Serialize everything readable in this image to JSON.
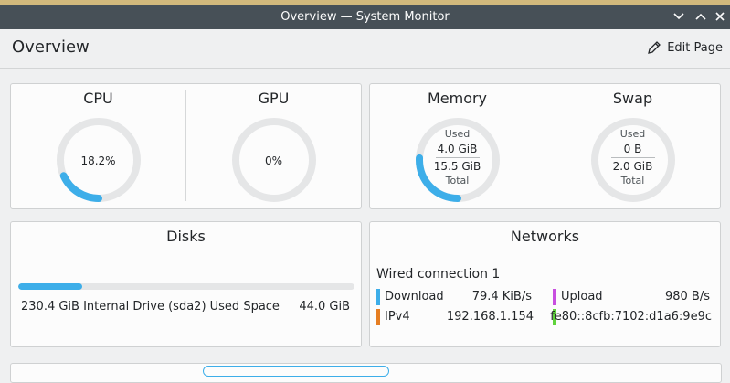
{
  "window": {
    "title": "Overview — System Monitor"
  },
  "header": {
    "title": "Overview",
    "edit_label": "Edit Page"
  },
  "colors": {
    "accent": "#3daee9",
    "ipv4": "#e67e22",
    "upload": "#c84fe0",
    "ipv6": "#5fd33b"
  },
  "cpu": {
    "title": "CPU",
    "value_text": "18.2%",
    "fraction": 0.182
  },
  "gpu": {
    "title": "GPU",
    "value_text": "0%",
    "fraction": 0.0
  },
  "memory": {
    "title": "Memory",
    "used_label": "Used",
    "used": "4.0 GiB",
    "total": "15.5 GiB",
    "total_label": "Total",
    "fraction": 0.258
  },
  "swap": {
    "title": "Swap",
    "used_label": "Used",
    "used": "0 B",
    "total": "2.0 GiB",
    "total_label": "Total",
    "fraction": 0.0
  },
  "disks": {
    "title": "Disks",
    "drive_label": "230.4 GiB Internal Drive (sda2) Used Space",
    "used": "44.0 GiB",
    "fraction": 0.19
  },
  "networks": {
    "title": "Networks",
    "connection": "Wired connection 1",
    "download_label": "Download",
    "download": "79.4 KiB/s",
    "upload_label": "Upload",
    "upload": "980 B/s",
    "ipv4_label": "IPv4",
    "ipv4": "192.168.1.154",
    "ipv6": "fe80::8cfb:7102:d1a6:9e9c"
  }
}
